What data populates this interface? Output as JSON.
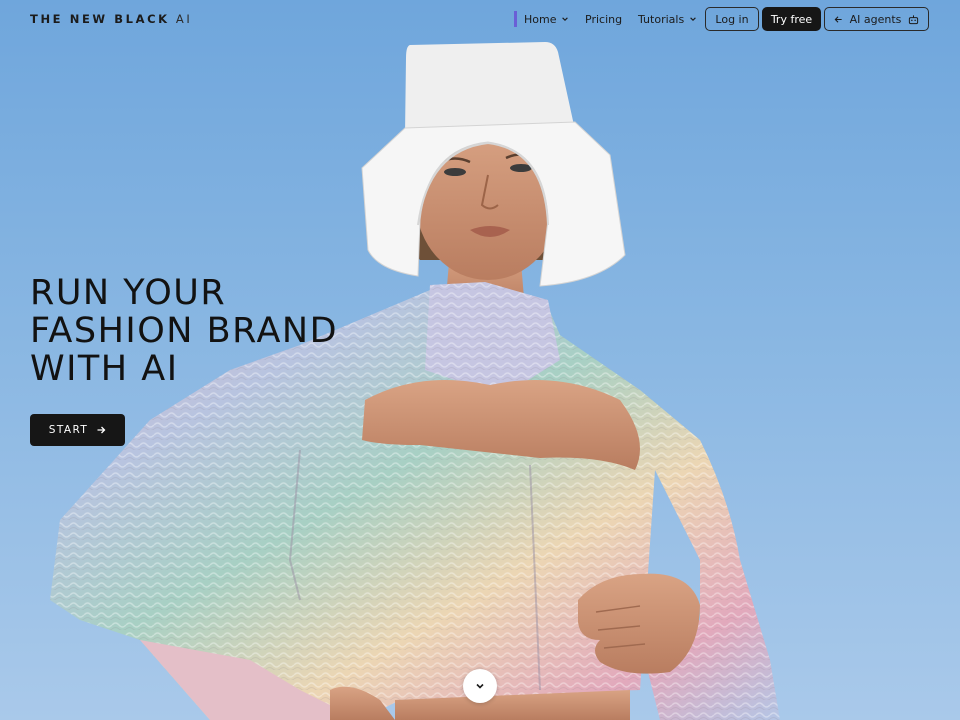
{
  "header": {
    "logo_brand": "THE NEW BLACK",
    "logo_suffix": "AI",
    "nav": {
      "home": "Home",
      "pricing": "Pricing",
      "tutorials": "Tutorials"
    },
    "login": "Log in",
    "try_free": "Try free",
    "ai_agents": "AI agents"
  },
  "hero": {
    "headline_lines": [
      "RUN YOUR",
      "FASHION BRAND",
      "WITH AI"
    ],
    "cta": "START"
  },
  "colors": {
    "sky_top": "#6fa6dc",
    "sky_bottom": "#a9c9ea",
    "dark": "#161616",
    "accent": "#6a5fd6"
  },
  "icons": {
    "home_dropdown": "chevron-down-icon",
    "tutorials_dropdown": "chevron-down-icon",
    "agents_arrow": "arrow-left-icon",
    "agents_robot": "robot-icon",
    "start_arrow": "arrow-right-icon",
    "scroll": "chevron-down-icon"
  }
}
